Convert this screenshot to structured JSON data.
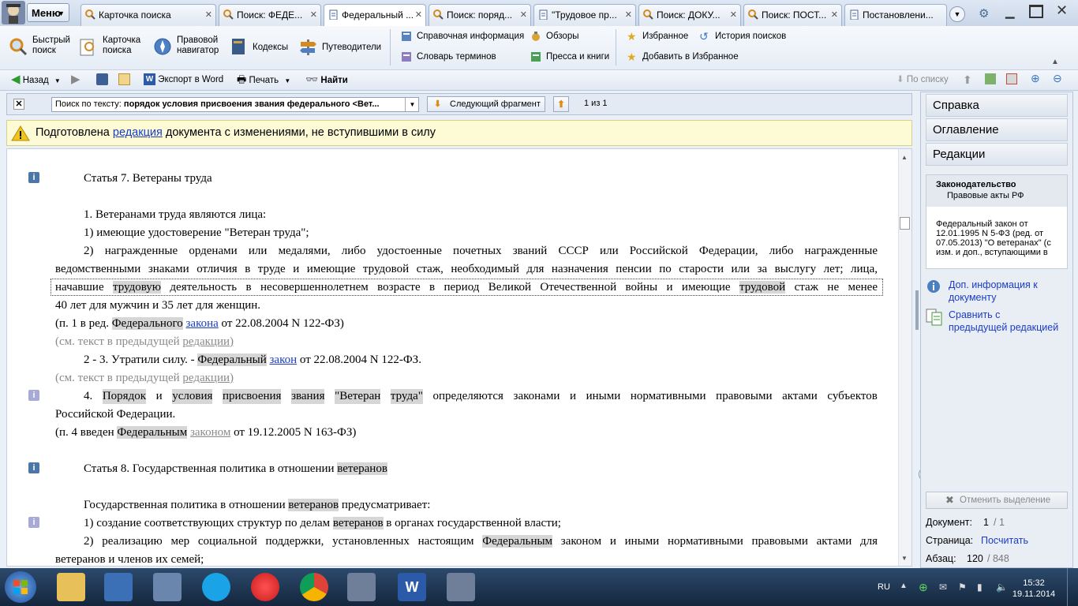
{
  "menu": {
    "label": "Меню"
  },
  "tabs": [
    {
      "label": "Карточка поиска"
    },
    {
      "label": "Поиск: ФЕДЕ..."
    },
    {
      "label": "Федеральный ..."
    },
    {
      "label": "Поиск: поряд..."
    },
    {
      "label": "\"Трудовое пр..."
    },
    {
      "label": "Поиск: ДОКУ..."
    },
    {
      "label": "Поиск: ПОСТ..."
    },
    {
      "label": "Постановлени..."
    }
  ],
  "toolbar": {
    "quick_search": "Быстрый поиск",
    "card_search": "Карточка поиска",
    "legal_navigator": "Правовой навигатор",
    "codes": "Кодексы",
    "guides": "Путеводители",
    "reference_info": "Справочная информация",
    "reviews": "Обзоры",
    "favorites": "Избранное",
    "search_history": "История поисков",
    "glossary": "Словарь терминов",
    "press_books": "Пресса и книги",
    "add_favorites": "Добавить в Избранное"
  },
  "toolbar2": {
    "back": "Назад",
    "export_word": "Экспорт в Word",
    "print": "Печать",
    "find": "Найти",
    "by_list": "По списку"
  },
  "searchbar": {
    "prefix": "Поиск по тексту:",
    "query": "порядок  условия присвоения звания федерального <Вет...",
    "next_fragment": "Следующий фрагмент",
    "counter": "1 из 1"
  },
  "notice": {
    "before": "Подготовлена ",
    "link": "редакция",
    "after": " документа с изменениями, не вступившими в силу"
  },
  "doc": {
    "art7_title": "Статья 7. Ветераны труда",
    "p1": "1. Ветеранами труда являются лица:",
    "p1_1": "1) имеющие удостоверение \"Ветеран труда\";",
    "p1_2a": "2) награжденные орденами или медалями, либо удостоенные почетных званий СССР или Российской Федерации, либо награжденные",
    "p1_2b": "ведомственными знаками отличия в труде и имеющие трудовой стаж, необходимый для назначения пенсии по старости или за выслугу лет; лица,",
    "p1_2c_1": "начавшие ",
    "p1_2c_hl1": "трудовую",
    "p1_2c_2": " деятельность в несовершеннолетнем возрасте в период Великой Отечественной войны и имеющие ",
    "p1_2c_hl2": "трудовой",
    "p1_2c_3": " стаж не менее",
    "p1_2d": "40 лет для мужчин и 35 лет для женщин.",
    "red1_a": "(п. 1 в ред. ",
    "red1_hl": "Федерального",
    "red1_sp": " ",
    "red1_link": "закона",
    "red1_b": " от 22.08.2004 N 122-ФЗ)",
    "prev1_a": "(см. текст в предыдущей ",
    "prev1_link": "редакции)",
    "p23_a": "2 - 3. Утратили силу. - ",
    "p23_hl": "Федеральный",
    "p23_sp": " ",
    "p23_link": "закон",
    "p23_b": " от 22.08.2004 N 122-ФЗ.",
    "prev2_a": "(см. текст в предыдущей ",
    "prev2_link": "редакции)",
    "p4_w1": "4.",
    "p4_w2": "Порядок",
    "p4_w3": "и",
    "p4_w4": "условия",
    "p4_w5": "присвоения",
    "p4_w6": "звания",
    "p4_w7": "\"Ветеран",
    "p4_w8": "труда\"",
    "p4_w9": "определяются",
    "p4_w10": "законами",
    "p4_w11": "и",
    "p4_w12": "иными",
    "p4_w13": "нормативными",
    "p4_w14": "правовыми",
    "p4_w15": "актами",
    "p4_w16": "субъектов",
    "p4_b": "Российской Федерации.",
    "red4_a": "(п. 4 введен ",
    "red4_hl": "Федеральным",
    "red4_sp": " ",
    "red4_link": "законом",
    "red4_b": " от 19.12.2005 N 163-ФЗ)",
    "art8_title_a": "Статья 8. Государственная политика в отношении ",
    "art8_title_hl": "ветеранов",
    "art8_p_a": "Государственная политика в отношении ",
    "art8_p_hl": "ветеранов",
    "art8_p_b": " предусматривает:",
    "art8_1_a": "1) создание соответствующих структур по делам ",
    "art8_1_hl": "ветеранов",
    "art8_1_b": " в органах государственной власти;",
    "art8_2_a": "2) реализацию мер социальной поддержки, установленных настоящим ",
    "art8_2_hl": "Федеральным",
    "art8_2_b": " законом и иными нормативными правовыми актами для",
    "art8_2c": "ветеранов и членов их семей;",
    "info_icon": "i"
  },
  "rpanel": {
    "help": "Справка",
    "toc": "Оглавление",
    "editions": "Редакции",
    "law_title": "Законодательство",
    "law_sub": "Правовые акты РФ",
    "law_desc_1": "Федеральный закон от",
    "law_desc_2": "12.01.1995 N 5-ФЗ (ред. от",
    "law_desc_3": "07.05.2013) \"О ветеранах\" (с",
    "law_desc_4": "изм. и доп., вступающими в",
    "more_info_1": "Доп. информация к",
    "more_info_2": "документу",
    "compare_1": "Сравнить с",
    "compare_2": "предыдущей редакцией",
    "clear_selection": "Отменить выделение",
    "document_label": "Документ:",
    "document_value": "1",
    "document_total": "/ 1",
    "page_label": "Страница:",
    "page_value": "Посчитать",
    "para_label": "Абзац:",
    "para_value": "120",
    "para_total": "/ 848"
  },
  "taskbar": {
    "lang": "RU",
    "time": "15:32",
    "date": "19.11.2014"
  }
}
